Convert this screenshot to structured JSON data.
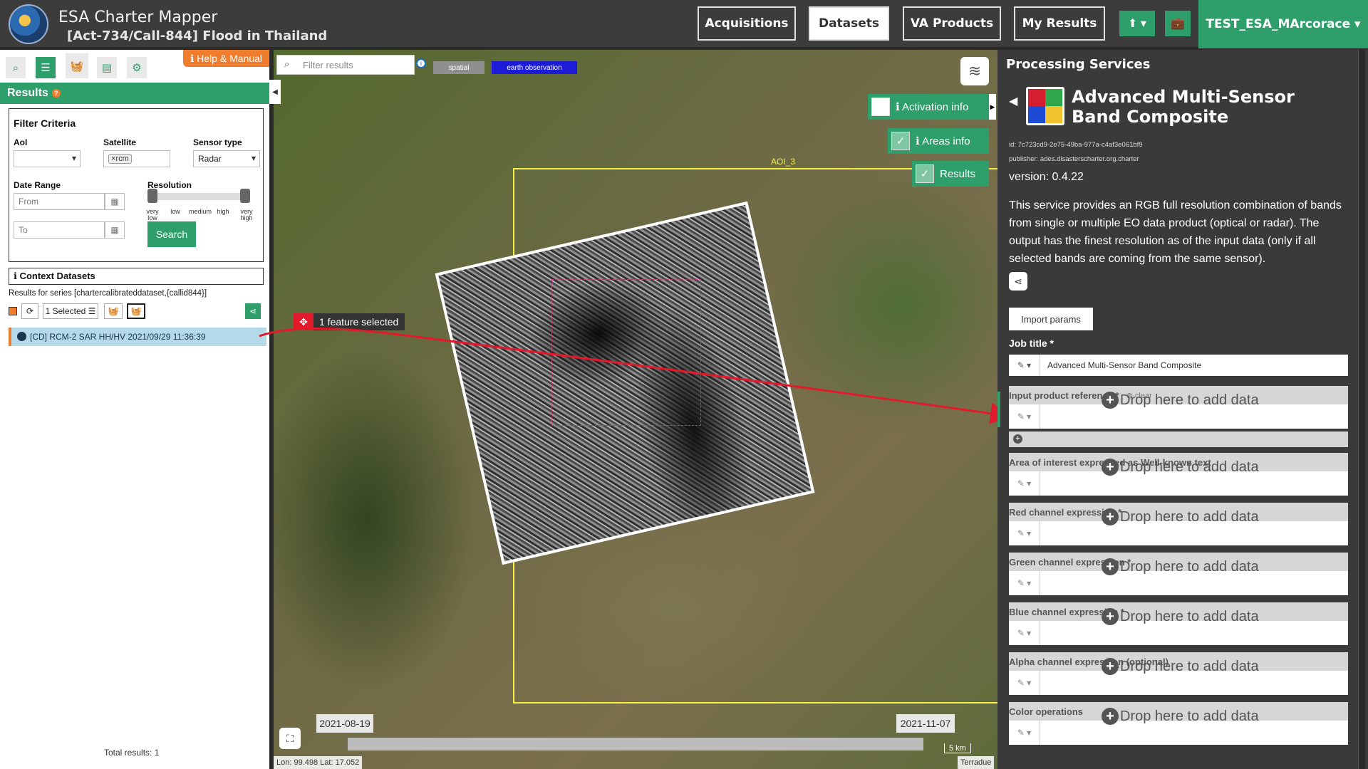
{
  "header": {
    "app_title": "ESA Charter Mapper",
    "subtitle": "[Act-734/Call-844] Flood in Thailand",
    "nav": [
      "Acquisitions",
      "Datasets",
      "VA Products",
      "My Results"
    ],
    "user": "TEST_ESA_MArcorace ▾",
    "upload_icon": "⬆ ▾",
    "briefcase_icon": "💼"
  },
  "left": {
    "help_label": "ℹ Help & Manual",
    "results_label": "Results",
    "results_q": "?",
    "filter_title": "Filter Criteria",
    "aoi_label": "AoI",
    "satellite_label": "Satellite",
    "satellite_tag": "×rcm",
    "sensor_label": "Sensor type",
    "sensor_value": "Radar",
    "date_label": "Date Range",
    "from_placeholder": "From",
    "to_placeholder": "To",
    "resolution_label": "Resolution",
    "res_levels": [
      "very low",
      "low",
      "medium",
      "high",
      "very high"
    ],
    "search_label": "Search",
    "context_label": "ℹ Context Datasets",
    "series_text": "Results for series [chartercalibrateddataset,{callid844}]",
    "selected_label": "1 Selected ☰",
    "result_item": "[CD] RCM-2 SAR HH/HV 2021/09/29 11:36:39",
    "total": "Total results: 1"
  },
  "map": {
    "filter_placeholder": "Filter results",
    "chip_spatial": "spatial",
    "chip_eo": "earth observation",
    "aoi_label": "AOI_3",
    "feature_selected": "1 feature selected",
    "activation_info": "ℹ Activation info",
    "areas_info": "ℹ Areas info",
    "results": "Results",
    "date_start": "2021-08-19",
    "date_end": "2021-11-07",
    "coords": "Lon: 99.498 Lat: 17.052",
    "scale": "5 km",
    "attribution": "Terradue"
  },
  "right": {
    "header": "Processing Services",
    "service_title": "Advanced Multi-Sensor Band Composite",
    "id": "id: 7c723cd9-2e75-49ba-977a-c4af3e061bf9",
    "publisher": "publisher: ades.disasterscharter.org.charter",
    "version": "version: 0.4.22",
    "description": "This service provides an RGB full resolution combination of bands from single or multiple EO data product (optical or radar). The output has the finest resolution as of the input data (only if all selected bands are coming from the same sensor).",
    "import_label": "Import params",
    "job_title_label": "Job title *",
    "job_title_value": "Advanced Multi-Sensor Band Composite",
    "clear_label": "⊗ clear",
    "drop_text": "Drop here to add data",
    "params": [
      "Input product reference *",
      "Area of interest expressed as Well-known text",
      "Red channel expression *",
      "Green channel expression *",
      "Blue channel expression *",
      "Alpha channel expression (optional)",
      "Color operations"
    ]
  },
  "colors": {
    "accent": "#2e9e6a",
    "orange": "#f07c2e",
    "aoi": "#f6f046",
    "arrow": "#e21a2c"
  }
}
